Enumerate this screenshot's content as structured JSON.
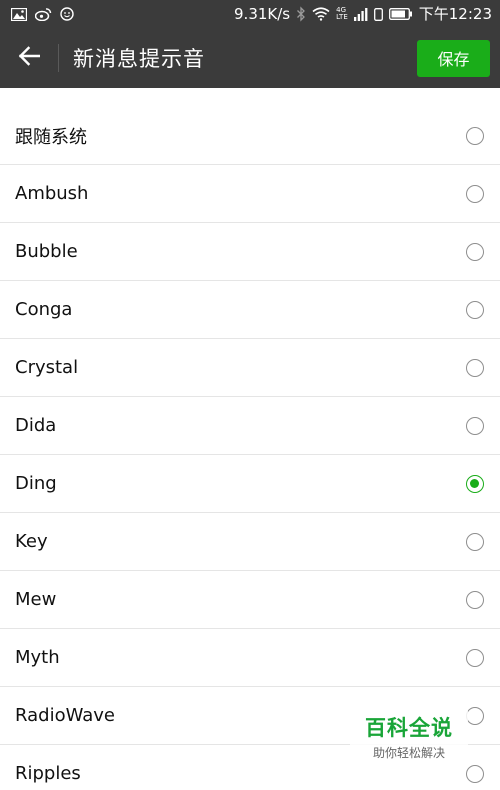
{
  "status_bar": {
    "network_speed": "9.31K/s",
    "network_type": "4G",
    "network_sub": "LTE",
    "time": "下午12:23",
    "icons": [
      "image-icon",
      "weibo-icon",
      "smiley-icon",
      "bluetooth-icon",
      "wifi-icon",
      "signal-icon",
      "sim-icon",
      "battery-icon"
    ]
  },
  "header": {
    "title": "新消息提示音",
    "save_label": "保存"
  },
  "ringtones": [
    {
      "label": "跟随系统",
      "selected": false
    },
    {
      "label": "Ambush",
      "selected": false
    },
    {
      "label": "Bubble",
      "selected": false
    },
    {
      "label": "Conga",
      "selected": false
    },
    {
      "label": "Crystal",
      "selected": false
    },
    {
      "label": "Dida",
      "selected": false
    },
    {
      "label": "Ding",
      "selected": true
    },
    {
      "label": "Key",
      "selected": false
    },
    {
      "label": "Mew",
      "selected": false
    },
    {
      "label": "Myth",
      "selected": false
    },
    {
      "label": "RadioWave",
      "selected": false
    },
    {
      "label": "Ripples",
      "selected": false
    }
  ],
  "watermark": {
    "main": "百科全说",
    "sub": "助你轻松解决"
  },
  "colors": {
    "bar_bg": "#3b3b3b",
    "accent": "#1aad19",
    "watermark": "#19a538"
  }
}
